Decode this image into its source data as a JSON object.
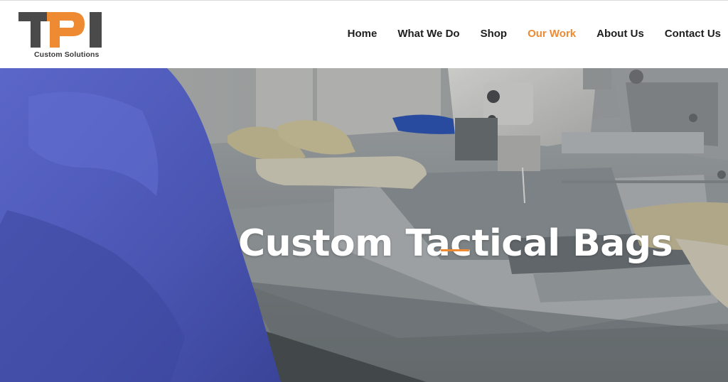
{
  "brand": {
    "logo_text": "TPI",
    "tagline": "Custom Solutions",
    "colors": {
      "dark": "#4a4a4a",
      "orange": "#ee8a32"
    }
  },
  "nav": {
    "items": [
      {
        "label": "Home",
        "active": false
      },
      {
        "label": "What We Do",
        "active": false
      },
      {
        "label": "Shop",
        "active": false
      },
      {
        "label": "Our Work",
        "active": true
      },
      {
        "label": "About Us",
        "active": false
      },
      {
        "label": "Contact Us",
        "active": false
      }
    ],
    "active_color": "#ee8a32"
  },
  "hero": {
    "title": "Custom Tactical Bags",
    "accent_color": "#ee8a32"
  }
}
